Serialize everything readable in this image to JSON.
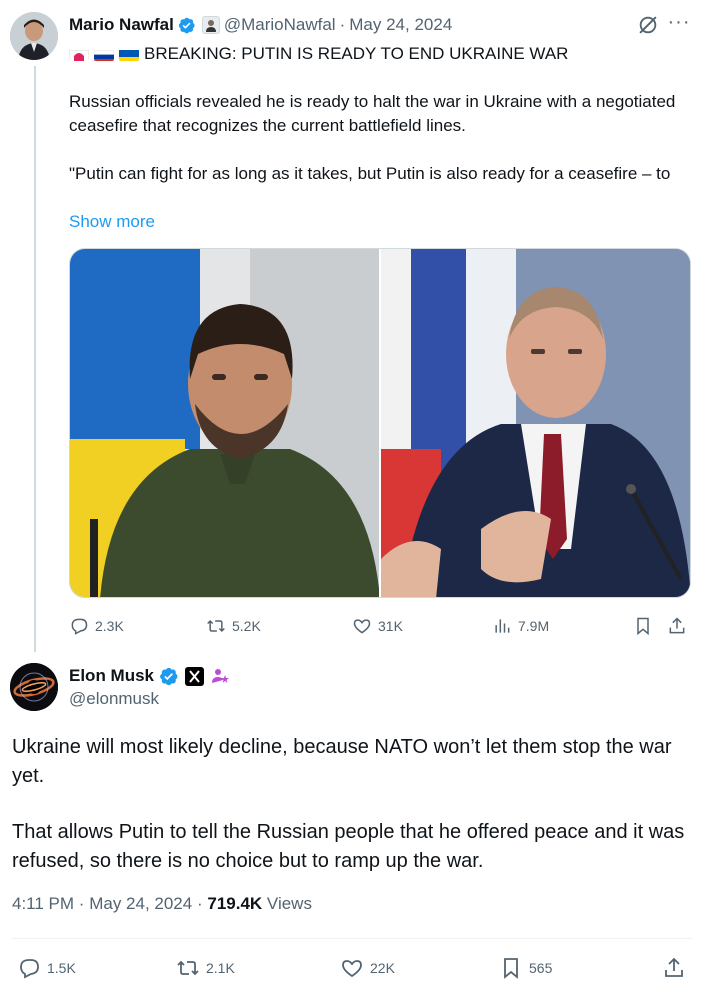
{
  "quoted_tweet": {
    "author_name": "Mario Nawfal",
    "author_handle": "@MarioNawfal",
    "separator": "·",
    "date": "May 24, 2024",
    "headline": "BREAKING: PUTIN IS READY TO END UKRAINE WAR",
    "paragraph_1": "Russian officials revealed he is ready to halt the war in Ukraine with a negotiated ceasefire that recognizes the current battlefield lines.",
    "paragraph_2": "\"Putin can fight for as long as it takes, but Putin is also ready for a ceasefire – to",
    "show_more": "Show more",
    "stats": {
      "replies": "2.3K",
      "reposts": "5.2K",
      "likes": "31K",
      "views": "7.9M"
    }
  },
  "main_tweet": {
    "author_name": "Elon Musk",
    "author_handle": "@elonmusk",
    "paragraph_1": "Ukraine will most likely decline, because NATO won’t let them stop the war yet.",
    "paragraph_2": "That allows Putin to tell the Russian people that he offered peace and it was refused, so there is no choice but to ramp up the war.",
    "time": "4:11 PM",
    "date": "May 24, 2024",
    "separator": "·",
    "views_count": "719.4K",
    "views_label": "Views",
    "stats": {
      "replies": "1.5K",
      "reposts": "2.1K",
      "likes": "22K",
      "bookmarks": "565"
    }
  },
  "colors": {
    "accent": "#1d9bf0",
    "text": "#0f1419",
    "secondary": "#536471",
    "border": "#cfd9de"
  },
  "icons": [
    "verified-badge-icon",
    "grok-icon",
    "more-icon",
    "reply-icon",
    "repost-icon",
    "like-icon",
    "views-icon",
    "bookmark-icon",
    "share-icon"
  ]
}
